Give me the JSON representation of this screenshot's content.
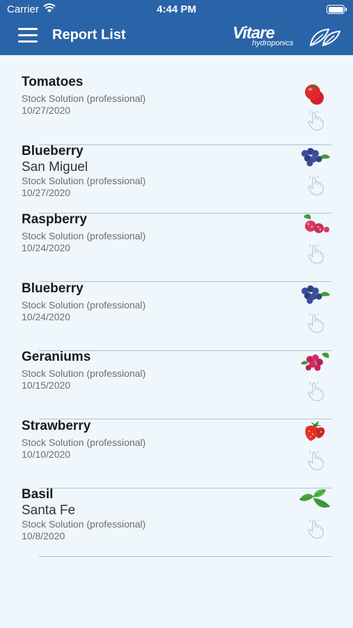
{
  "status_bar": {
    "carrier": "Carrier",
    "time": "4:44 PM"
  },
  "header": {
    "title": "Report List",
    "logo_text": "Vitare",
    "logo_sub": "hydroponics"
  },
  "colors": {
    "header": "#2a64a8",
    "background": "#eff6fc",
    "divider": "#a9c3cc"
  },
  "reports": [
    {
      "name": "Tomatoes",
      "location": "",
      "solution": "Stock Solution (professional)",
      "date": "10/27/2020",
      "icon": "tomato-icon"
    },
    {
      "name": "Blueberry",
      "location": "San Miguel",
      "solution": "Stock Solution (professional)",
      "date": "10/27/2020",
      "icon": "blueberry-icon"
    },
    {
      "name": "Raspberry",
      "location": "",
      "solution": "Stock Solution (professional)",
      "date": "10/24/2020",
      "icon": "raspberry-icon"
    },
    {
      "name": "Blueberry",
      "location": "",
      "solution": "Stock Solution (professional)",
      "date": "10/24/2020",
      "icon": "blueberry-icon"
    },
    {
      "name": "Geraniums",
      "location": "",
      "solution": "Stock Solution (professional)",
      "date": "10/15/2020",
      "icon": "geranium-icon"
    },
    {
      "name": "Strawberry",
      "location": "",
      "solution": "Stock Solution (professional)",
      "date": "10/10/2020",
      "icon": "strawberry-icon"
    },
    {
      "name": "Basil",
      "location": "Santa Fe",
      "solution": "Stock Solution (professional)",
      "date": "10/8/2020",
      "icon": "basil-icon"
    }
  ]
}
